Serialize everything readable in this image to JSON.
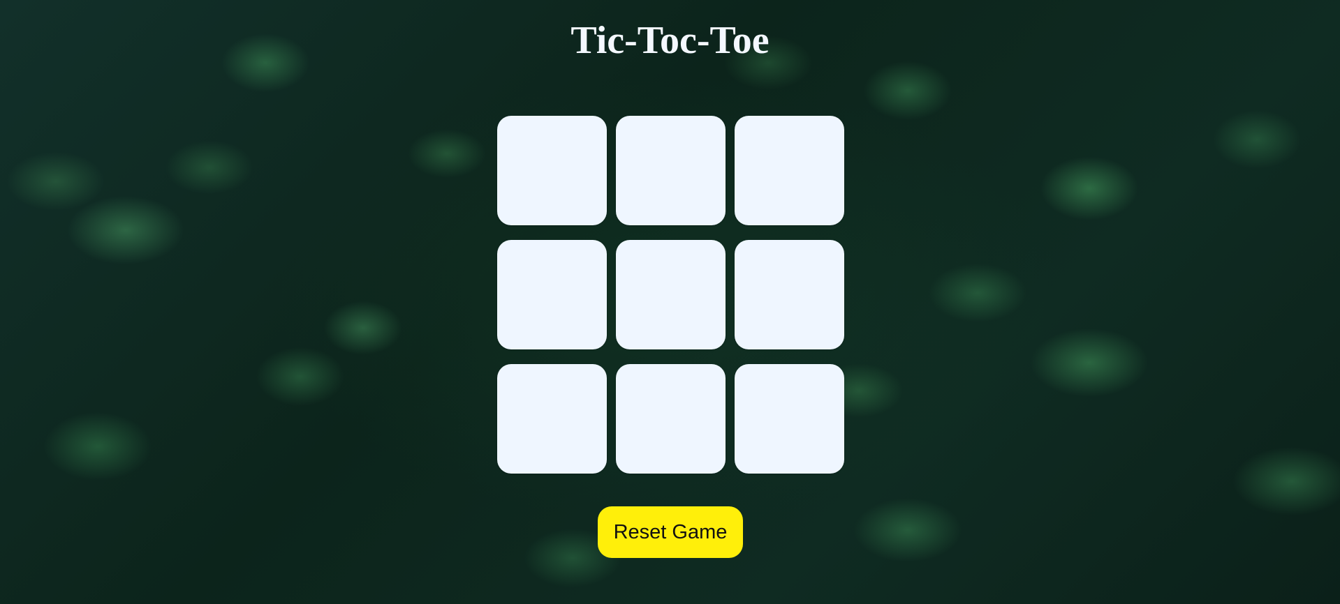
{
  "game": {
    "title": "Tic-Toc-Toe",
    "cells": [
      "",
      "",
      "",
      "",
      "",
      "",
      "",
      "",
      ""
    ],
    "reset_label": "Reset Game"
  },
  "colors": {
    "cell_background": "#eff6ff",
    "reset_button": "#ffef0a",
    "title_text": "#f4f8ff"
  }
}
